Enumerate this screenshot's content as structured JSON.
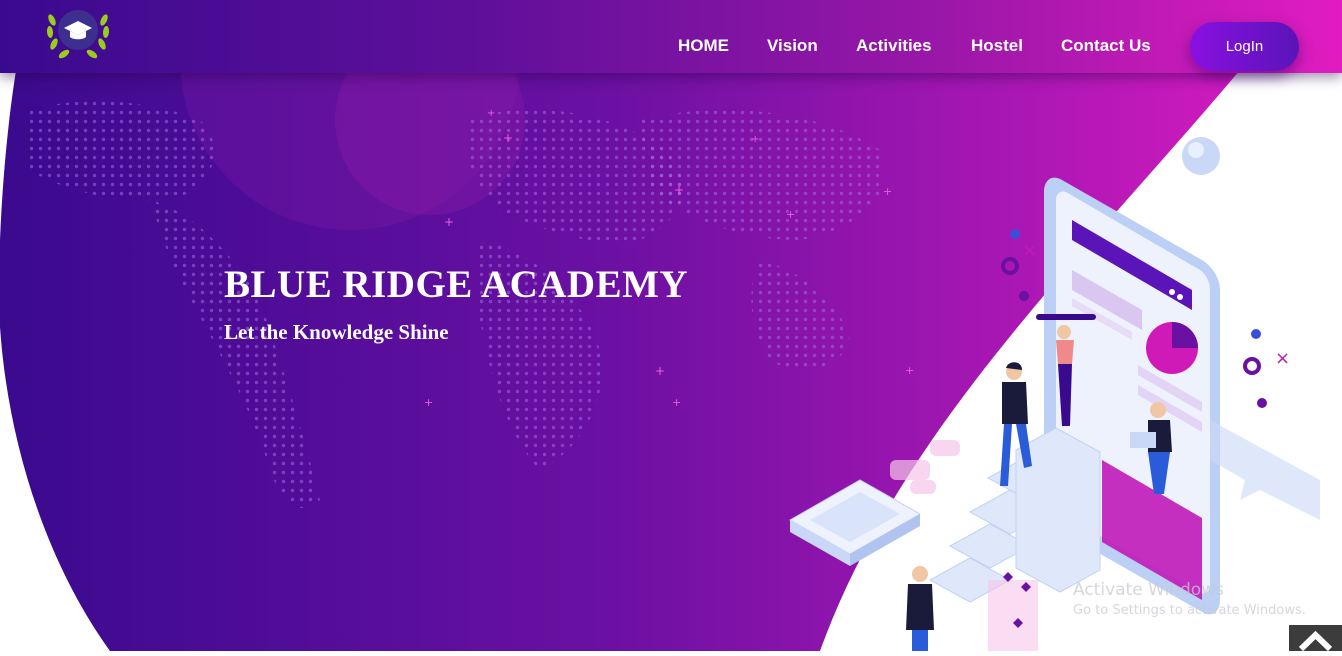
{
  "brand": {
    "logo_icon": "graduation-cap-laurel-icon",
    "colors": {
      "nav_start": "#3a0a8e",
      "nav_end": "#e11cc0",
      "hero_purple": "#4b0ca0",
      "hero_magenta": "#c01ab8"
    }
  },
  "nav": {
    "items": [
      {
        "label": "HOME"
      },
      {
        "label": "Vision"
      },
      {
        "label": "Activities"
      },
      {
        "label": "Hostel"
      },
      {
        "label": "Contact Us"
      }
    ],
    "login_label": "LogIn"
  },
  "hero": {
    "title": "BLUE RIDGE ACADEMY",
    "tagline": "Let the Knowledge Shine",
    "illustration": "people-climbing-steps-to-smartphone-illustration"
  },
  "watermark": {
    "title": "Activate Windows",
    "subtitle": "Go to Settings to activate Windows."
  },
  "scroll_top_icon": "chevron-up-icon"
}
